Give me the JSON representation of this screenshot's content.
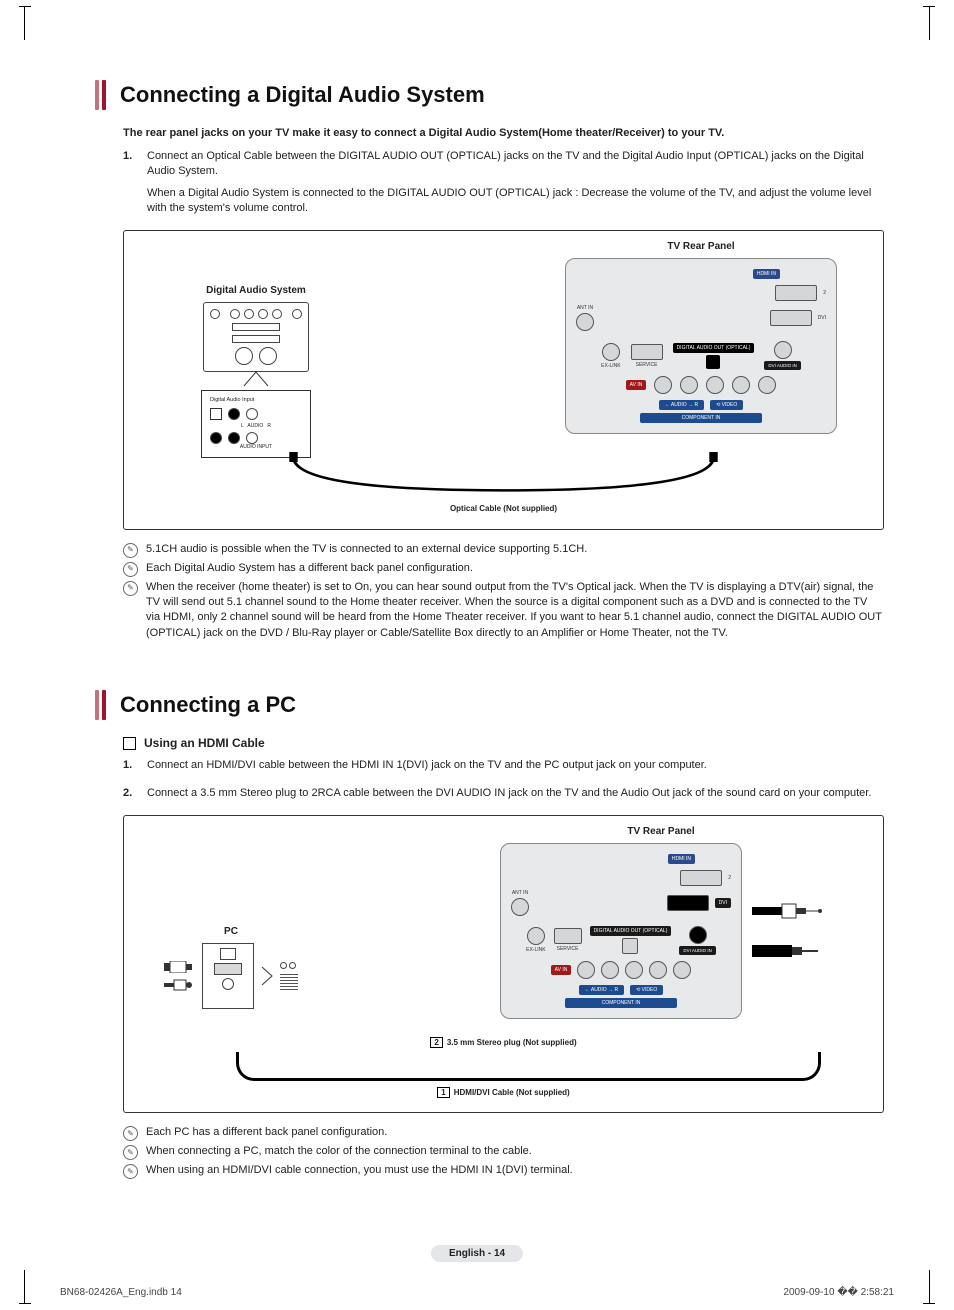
{
  "section1": {
    "title": "Connecting a Digital Audio System",
    "intro": "The rear panel jacks on your TV make it easy to connect a Digital Audio System(Home theater/Receiver) to your TV.",
    "steps": [
      {
        "num": "1.",
        "paras": [
          "Connect an Optical Cable between the DIGITAL AUDIO OUT (OPTICAL) jacks on the TV and the Digital Audio Input (OPTICAL) jacks on the Digital Audio System.",
          "When a Digital Audio System is connected to the DIGITAL AUDIO OUT (OPTICAL) jack : Decrease the volume of the TV, and adjust the volume level with the system's volume control."
        ]
      }
    ],
    "diagram": {
      "left_title": "Digital Audio System",
      "right_title": "TV Rear Panel",
      "cable_label": "Optical Cable (Not supplied)",
      "rear_labels": {
        "hdmi_in": "HDMI IN",
        "ant_in": "ANT IN",
        "dvi": "DVI",
        "ex_link": "EX-LINK",
        "service": "SERVICE",
        "digital_out": "DIGITAL AUDIO OUT (OPTICAL)",
        "dvi_audio_in": "DVI AUDIO IN",
        "av_in": "AV IN",
        "audio_lr": "← AUDIO → R",
        "component_in": "COMPONENT IN",
        "video": "⟲ VIDEO"
      }
    },
    "notes": [
      "5.1CH audio is possible when the TV is connected to an external device supporting 5.1CH.",
      "Each Digital Audio System has a different back panel configuration.",
      "When the receiver (home theater) is set to On, you can hear sound output from the TV's Optical jack. When the TV is displaying a DTV(air) signal, the TV will send out 5.1 channel sound to the Home theater receiver. When the source is a digital component such as a DVD and is connected to the TV via HDMI, only 2 channel sound will be heard from the Home Theater receiver. If you want to hear 5.1 channel audio, connect the DIGITAL AUDIO OUT (OPTICAL) jack on the DVD / Blu-Ray player or Cable/Satellite Box directly to an Amplifier or Home Theater, not the TV."
    ]
  },
  "section2": {
    "title": "Connecting a PC",
    "sub": "Using an HDMI Cable",
    "steps": [
      {
        "num": "1.",
        "paras": [
          "Connect an HDMI/DVI cable between the HDMI IN 1(DVI) jack on the TV and the PC output jack on your computer."
        ]
      },
      {
        "num": "2.",
        "paras": [
          "Connect a 3.5 mm Stereo plug to 2RCA cable between the DVI AUDIO IN jack on the TV and the Audio Out jack of the sound card on your computer."
        ]
      }
    ],
    "diagram": {
      "left_title": "PC",
      "right_title": "TV Rear Panel",
      "cable1_num": "2",
      "cable1_label": "3.5 mm Stereo plug (Not supplied)",
      "cable2_num": "1",
      "cable2_label": "HDMI/DVI Cable (Not supplied)",
      "rear_labels": {
        "hdmi_in": "HDMI IN",
        "ant_in": "ANT IN",
        "dvi": "DVI",
        "ex_link": "EX-LINK",
        "service": "SERVICE",
        "digital_out": "DIGITAL AUDIO OUT (OPTICAL)",
        "dvi_audio_in": "DVI AUDIO IN",
        "av_in": "AV IN",
        "audio_lr": "← AUDIO → R",
        "component_in": "COMPONENT IN",
        "video": "⟲ VIDEO"
      }
    },
    "notes": [
      "Each PC has a different back panel configuration.",
      "When connecting a PC, match the color of the connection terminal to the cable.",
      "When using an HDMI/DVI cable connection, you must use the HDMI IN 1(DVI) terminal."
    ]
  },
  "footer": {
    "center": "English - 14",
    "left": "BN68-02426A_Eng.indb   14",
    "right": "2009-09-10   �� 2:58:21"
  }
}
